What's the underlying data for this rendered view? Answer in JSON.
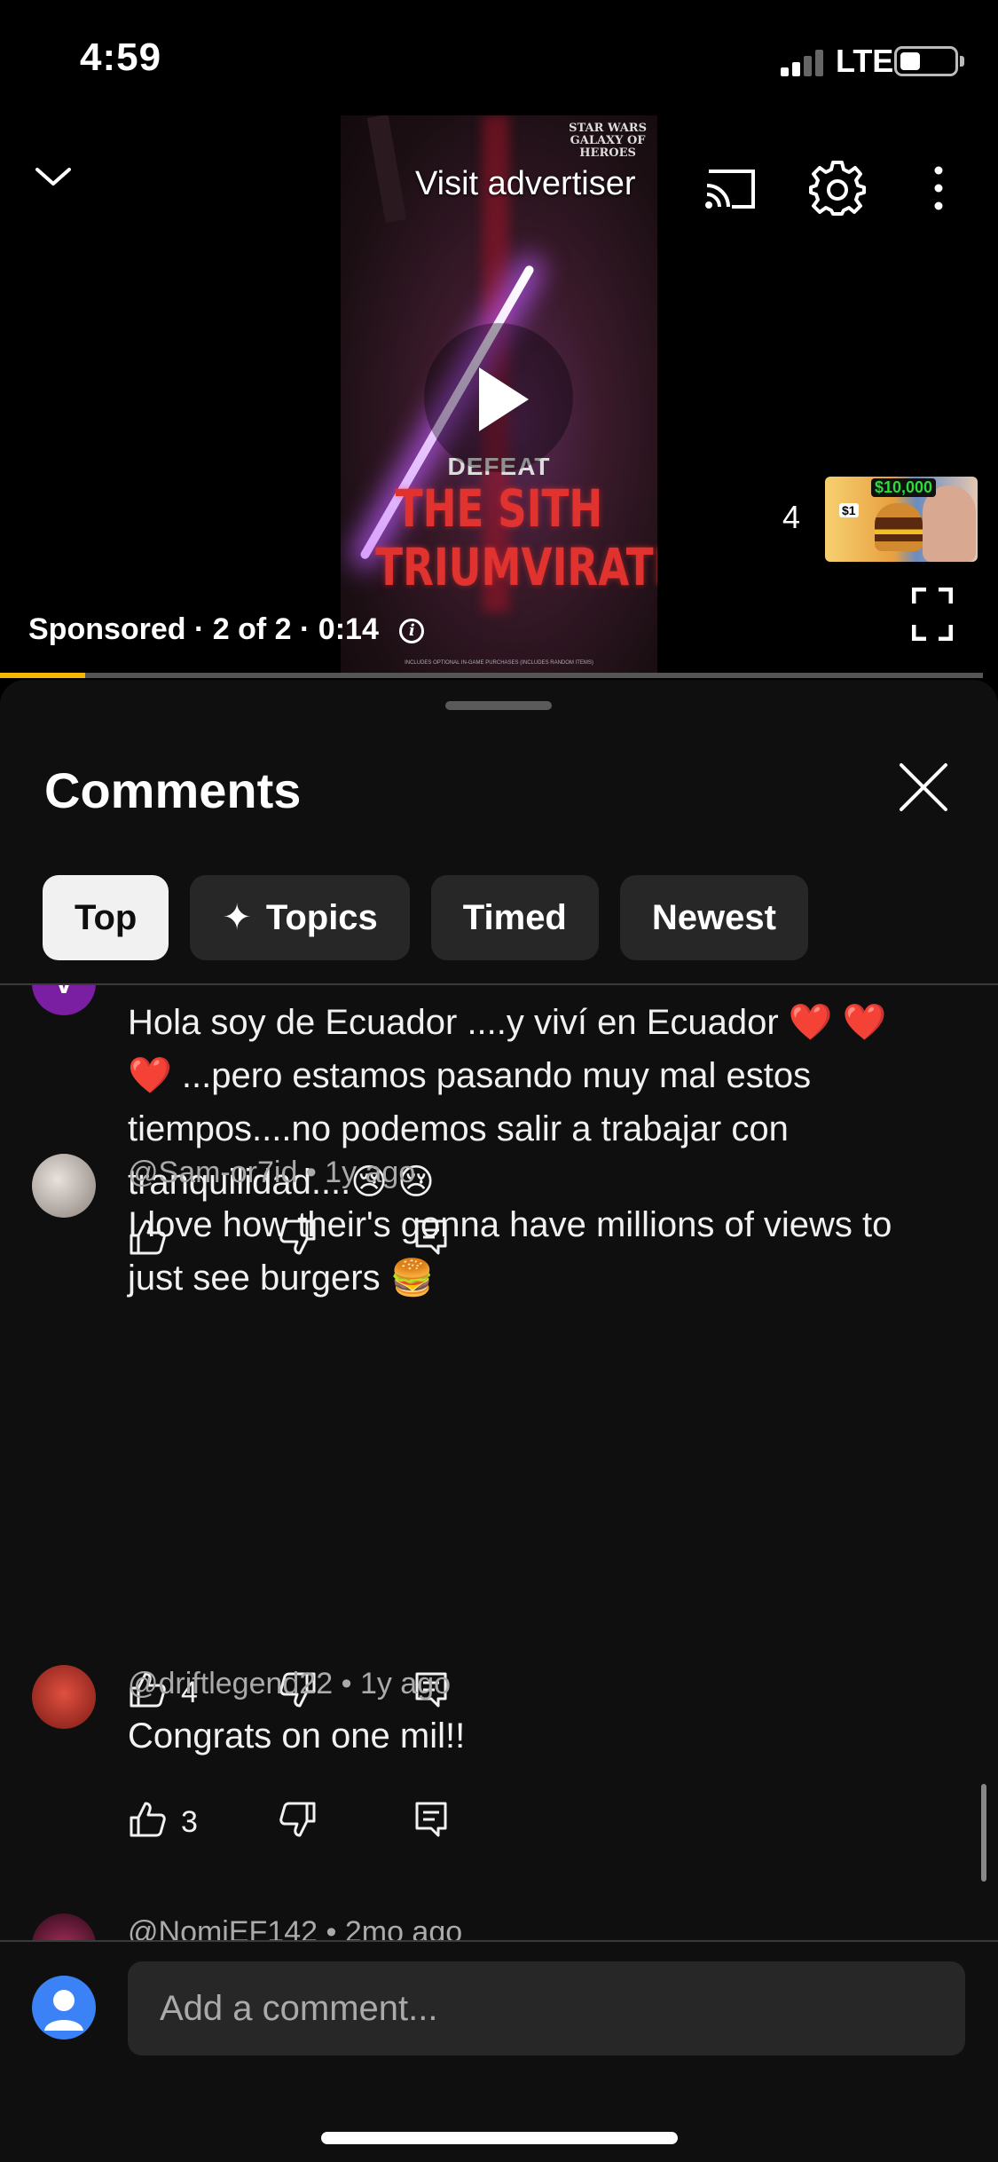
{
  "status_bar": {
    "time": "4:59",
    "network": "LTE",
    "signal_bars_active": 2,
    "signal_bars_total": 4,
    "battery_level": 0.3
  },
  "player": {
    "visit_advertiser": "Visit advertiser",
    "ad_info": "Sponsored · 2 of 2 · 0:14",
    "ad_creative": {
      "brand_lines": [
        "STAR WARS",
        "GALAXY OF",
        "HEROES"
      ],
      "defeat": "DEFEAT",
      "title_line1": "THE SITH",
      "title_line2": "TRIUMVIRATE",
      "fine_print": "INCLUDES OPTIONAL IN-GAME PURCHASES (INCLUDES RANDOM ITEMS)"
    },
    "next_count": "4",
    "next_thumb": {
      "price_big": "$10,000",
      "price_small": "$1"
    },
    "progress_fraction": 0.087,
    "icons": {
      "collapse": "chevron-down-icon",
      "cast": "cast-icon",
      "settings": "gear-icon",
      "more": "more-vert-icon",
      "fullscreen": "fullscreen-icon",
      "info": "info-icon",
      "play": "play-icon"
    }
  },
  "comments_panel": {
    "title": "Comments",
    "chips": [
      {
        "label": "Top",
        "active": true
      },
      {
        "label": "Topics",
        "icon": "✦"
      },
      {
        "label": "Timed"
      },
      {
        "label": "Newest"
      }
    ],
    "comments": [
      {
        "avatar_letter": "V",
        "avatar_color": "#7b1fa2",
        "text": "Hola soy de Ecuador ....y viví en Ecuador ❤️ ❤️ ❤️ ...pero estamos pasando muy mal estos tiempos....no podemos salir a trabajar con tranquilidad....😢 😢",
        "likes": ""
      },
      {
        "author": "@Sam-or7id",
        "time": "1y ago",
        "text": "I love how their's gonna have millions of views to just see burgers 🍔",
        "likes": "4",
        "avatar_color": "#c9c2bb"
      },
      {
        "author": "@driftlegend22",
        "time": "1y ago",
        "text": "Congrats on one mil!!",
        "likes": "3",
        "avatar_color": "#c0392b"
      },
      {
        "author": "@NomiEF142",
        "time": "2mo ago",
        "text": "",
        "likes": ""
      }
    ],
    "add_comment_placeholder": "Add a comment...",
    "accent_color": "#f5b800"
  }
}
